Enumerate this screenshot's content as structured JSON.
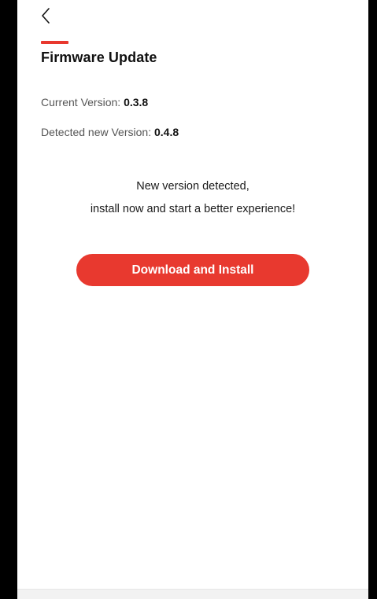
{
  "nav": {
    "back_icon": "chevron-left-icon"
  },
  "page": {
    "title": "Firmware Update",
    "accent_color": "#e8382e"
  },
  "versions": {
    "current_label": "Current Version: ",
    "current_value": "0.3.8",
    "detected_label": "Detected new Version: ",
    "detected_value": "0.4.8"
  },
  "message": {
    "line1": "New version detected,",
    "line2": "install now and start a better experience!"
  },
  "actions": {
    "download_label": "Download and Install",
    "button_color": "#e8392f"
  }
}
